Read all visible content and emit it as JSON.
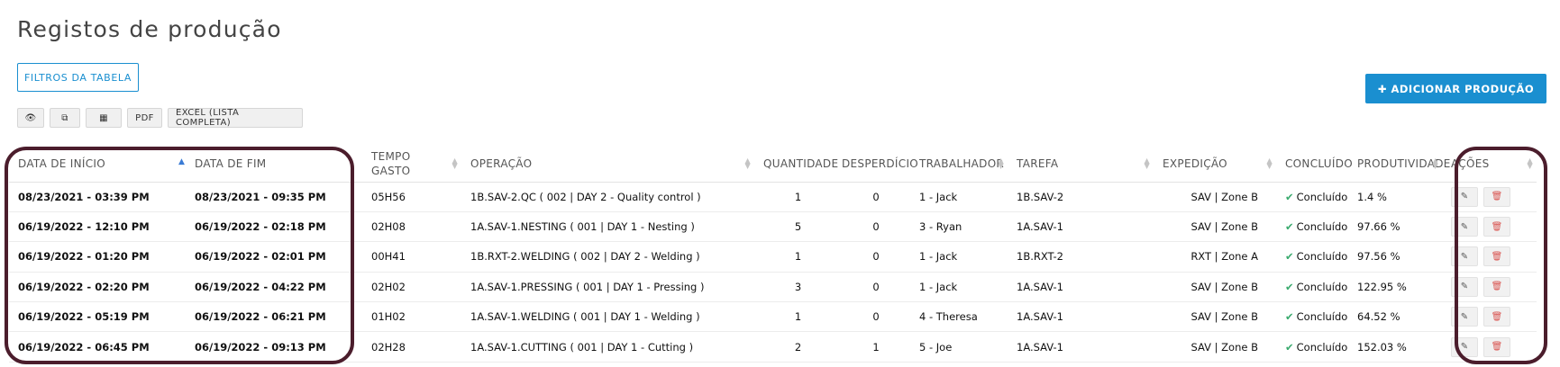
{
  "page": {
    "title": "Registos de produção"
  },
  "filters_button": "FILTROS DA TABELA",
  "add_button": "✚ ADICIONAR PRODUÇÃO",
  "toolbar": {
    "view_icon": "eye-icon",
    "copy_icon": "copy-icon",
    "csv_icon": "table-icon",
    "pdf": "PDF",
    "excel": "EXCEL (LISTA COMPLETA)"
  },
  "table": {
    "headers": {
      "start": "DATA DE INÍCIO",
      "end": "DATA DE FIM",
      "time_line1": "TEMPO",
      "time_line2": "GASTO",
      "operation": "OPERAÇÃO",
      "quantity": "QUANTIDADE",
      "waste": "DESPERDÍCIO",
      "worker": "TRABALHADOR",
      "task": "TAREFA",
      "shipping": "EXPEDIÇÃO",
      "done": "CONCLUÍDO",
      "productivity": "PRODUTIVIDADE",
      "actions": "AÇÕES"
    },
    "rows": [
      {
        "start": "08/23/2021 - 03:39 PM",
        "end": "08/23/2021 - 09:35 PM",
        "time": "05H56",
        "operation": "1B.SAV-2.QC ( 002 | DAY 2 - Quality control )",
        "quantity": "1",
        "waste": "0",
        "worker": "1 - Jack",
        "task": "1B.SAV-2",
        "shipping": "SAV | Zone B",
        "done": "Concluído",
        "productivity": "1.4 %"
      },
      {
        "start": "06/19/2022 - 12:10 PM",
        "end": "06/19/2022 - 02:18 PM",
        "time": "02H08",
        "operation": "1A.SAV-1.NESTING ( 001 | DAY 1 - Nesting )",
        "quantity": "5",
        "waste": "0",
        "worker": "3 - Ryan",
        "task": "1A.SAV-1",
        "shipping": "SAV | Zone B",
        "done": "Concluído",
        "productivity": "97.66 %"
      },
      {
        "start": "06/19/2022 - 01:20 PM",
        "end": "06/19/2022 - 02:01 PM",
        "time": "00H41",
        "operation": "1B.RXT-2.WELDING ( 002 | DAY 2 - Welding )",
        "quantity": "1",
        "waste": "0",
        "worker": "1 - Jack",
        "task": "1B.RXT-2",
        "shipping": "RXT | Zone A",
        "done": "Concluído",
        "productivity": "97.56 %"
      },
      {
        "start": "06/19/2022 - 02:20 PM",
        "end": "06/19/2022 - 04:22 PM",
        "time": "02H02",
        "operation": "1A.SAV-1.PRESSING ( 001 | DAY 1 - Pressing )",
        "quantity": "3",
        "waste": "0",
        "worker": "1 - Jack",
        "task": "1A.SAV-1",
        "shipping": "SAV | Zone B",
        "done": "Concluído",
        "productivity": "122.95 %"
      },
      {
        "start": "06/19/2022 - 05:19 PM",
        "end": "06/19/2022 - 06:21 PM",
        "time": "01H02",
        "operation": "1A.SAV-1.WELDING ( 001 | DAY 1 - Welding )",
        "quantity": "1",
        "waste": "0",
        "worker": "4 - Theresa",
        "task": "1A.SAV-1",
        "shipping": "SAV | Zone B",
        "done": "Concluído",
        "productivity": "64.52 %"
      },
      {
        "start": "06/19/2022 - 06:45 PM",
        "end": "06/19/2022 - 09:13 PM",
        "time": "02H28",
        "operation": "1A.SAV-1.CUTTING ( 001 | DAY 1 - Cutting )",
        "quantity": "2",
        "waste": "1",
        "worker": "5 - Joe",
        "task": "1A.SAV-1",
        "shipping": "SAV | Zone B",
        "done": "Concluído",
        "productivity": "152.03 %"
      }
    ]
  },
  "colors": {
    "accent": "#1a8fd0",
    "date_link": "#3a7bd5",
    "success": "#3aaa6e",
    "highlight": "#4b1d2c",
    "danger": "#d9534f"
  }
}
